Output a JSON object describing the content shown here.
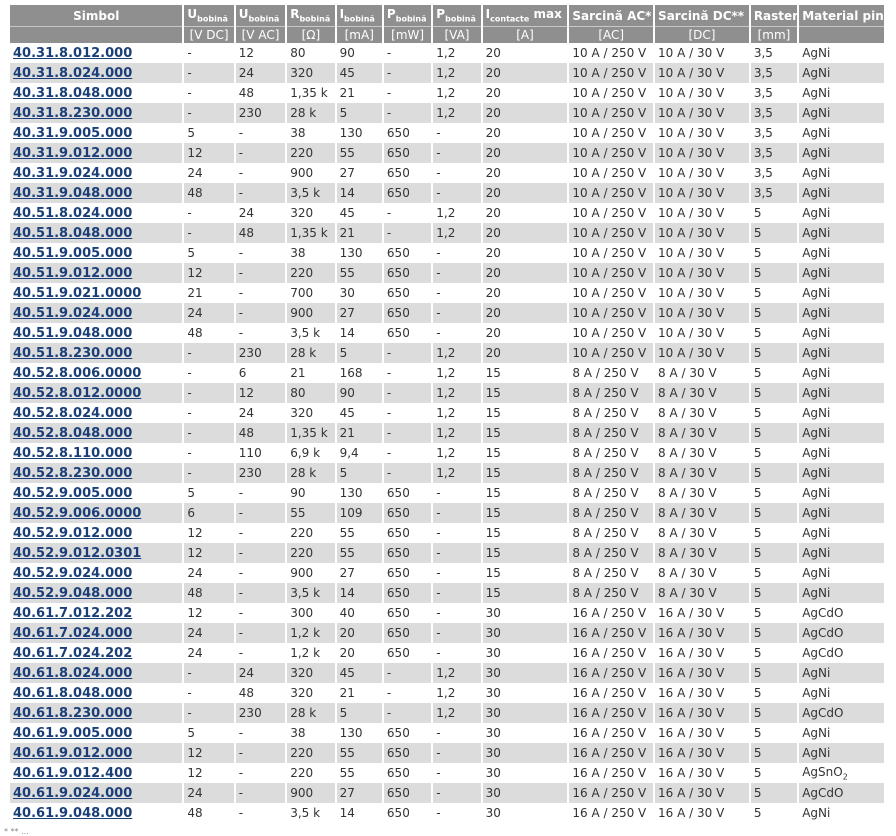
{
  "headers": {
    "symbol": "Simbol",
    "u_dc": {
      "base": "U",
      "sub": "bobină"
    },
    "u_ac": {
      "base": "U",
      "sub": "bobină"
    },
    "r": {
      "base": "R",
      "sub": "bobină"
    },
    "i": {
      "base": "I",
      "sub": "bobină"
    },
    "p_mw": {
      "base": "P",
      "sub": "bobină"
    },
    "p_va": {
      "base": "P",
      "sub": "bobină"
    },
    "i_contact": {
      "base": "I",
      "sub": "contacte",
      "suffix": " max"
    },
    "load_ac": "Sarcină AC*",
    "load_dc": "Sarcină DC**",
    "raster": "Raster",
    "material": "Material pin"
  },
  "units": [
    "",
    "[V DC]",
    "[V AC]",
    "[Ω]",
    "[mA]",
    "[mW]",
    "[VA]",
    "[A]",
    "[AC]",
    "[DC]",
    "[mm]",
    ""
  ],
  "rows": [
    [
      "40.31.8.012.000",
      "-",
      "12",
      "80",
      "90",
      "-",
      "1,2",
      "20",
      "10 A / 250 V",
      "10 A / 30 V",
      "3,5",
      "AgNi"
    ],
    [
      "40.31.8.024.000",
      "-",
      "24",
      "320",
      "45",
      "-",
      "1,2",
      "20",
      "10 A / 250 V",
      "10 A / 30 V",
      "3,5",
      "AgNi"
    ],
    [
      "40.31.8.048.000",
      "-",
      "48",
      "1,35 k",
      "21",
      "-",
      "1,2",
      "20",
      "10 A / 250 V",
      "10 A / 30 V",
      "3,5",
      "AgNi"
    ],
    [
      "40.31.8.230.000",
      "-",
      "230",
      "28 k",
      "5",
      "-",
      "1,2",
      "20",
      "10 A / 250 V",
      "10 A / 30 V",
      "3,5",
      "AgNi"
    ],
    [
      "40.31.9.005.000",
      "5",
      "-",
      "38",
      "130",
      "650",
      "-",
      "20",
      "10 A / 250 V",
      "10 A / 30 V",
      "3,5",
      "AgNi"
    ],
    [
      "40.31.9.012.000",
      "12",
      "-",
      "220",
      "55",
      "650",
      "-",
      "20",
      "10 A / 250 V",
      "10 A / 30 V",
      "3,5",
      "AgNi"
    ],
    [
      "40.31.9.024.000",
      "24",
      "-",
      "900",
      "27",
      "650",
      "-",
      "20",
      "10 A / 250 V",
      "10 A / 30 V",
      "3,5",
      "AgNi"
    ],
    [
      "40.31.9.048.000",
      "48",
      "-",
      "3,5 k",
      "14",
      "650",
      "-",
      "20",
      "10 A / 250 V",
      "10 A / 30 V",
      "3,5",
      "AgNi"
    ],
    [
      "40.51.8.024.000",
      "-",
      "24",
      "320",
      "45",
      "-",
      "1,2",
      "20",
      "10 A / 250 V",
      "10 A / 30 V",
      "5",
      "AgNi"
    ],
    [
      "40.51.8.048.000",
      "-",
      "48",
      "1,35 k",
      "21",
      "-",
      "1,2",
      "20",
      "10 A / 250 V",
      "10 A / 30 V",
      "5",
      "AgNi"
    ],
    [
      "40.51.9.005.000",
      "5",
      "-",
      "38",
      "130",
      "650",
      "-",
      "20",
      "10 A / 250 V",
      "10 A / 30 V",
      "5",
      "AgNi"
    ],
    [
      "40.51.9.012.000",
      "12",
      "-",
      "220",
      "55",
      "650",
      "-",
      "20",
      "10 A / 250 V",
      "10 A / 30 V",
      "5",
      "AgNi"
    ],
    [
      "40.51.9.021.0000",
      "21",
      "-",
      "700",
      "30",
      "650",
      "-",
      "20",
      "10 A / 250 V",
      "10 A / 30 V",
      "5",
      "AgNi"
    ],
    [
      "40.51.9.024.000",
      "24",
      "-",
      "900",
      "27",
      "650",
      "-",
      "20",
      "10 A / 250 V",
      "10 A / 30 V",
      "5",
      "AgNi"
    ],
    [
      "40.51.9.048.000",
      "48",
      "-",
      "3,5 k",
      "14",
      "650",
      "-",
      "20",
      "10 A / 250 V",
      "10 A / 30 V",
      "5",
      "AgNi"
    ],
    [
      "40.51.8.230.000",
      "-",
      "230",
      "28 k",
      "5",
      "-",
      "1,2",
      "20",
      "10 A / 250 V",
      "10 A / 30 V",
      "5",
      "AgNi"
    ],
    [
      "40.52.8.006.0000",
      "-",
      "6",
      "21",
      "168",
      "-",
      "1,2",
      "15",
      "8 A / 250 V",
      "8 A / 30 V",
      "5",
      "AgNi"
    ],
    [
      "40.52.8.012.0000",
      "-",
      "12",
      "80",
      "90",
      "-",
      "1,2",
      "15",
      "8 A / 250 V",
      "8 A / 30 V",
      "5",
      "AgNi"
    ],
    [
      "40.52.8.024.000",
      "-",
      "24",
      "320",
      "45",
      "-",
      "1,2",
      "15",
      "8 A / 250 V",
      "8 A / 30 V",
      "5",
      "AgNi"
    ],
    [
      "40.52.8.048.000",
      "-",
      "48",
      "1,35 k",
      "21",
      "-",
      "1,2",
      "15",
      "8 A / 250 V",
      "8 A / 30 V",
      "5",
      "AgNi"
    ],
    [
      "40.52.8.110.000",
      "-",
      "110",
      "6,9 k",
      "9,4",
      "-",
      "1,2",
      "15",
      "8 A / 250 V",
      "8 A / 30 V",
      "5",
      "AgNi"
    ],
    [
      "40.52.8.230.000",
      "-",
      "230",
      "28 k",
      "5",
      "-",
      "1,2",
      "15",
      "8 A / 250 V",
      "8 A / 30 V",
      "5",
      "AgNi"
    ],
    [
      "40.52.9.005.000",
      "5",
      "-",
      "90",
      "130",
      "650",
      "-",
      "15",
      "8 A / 250 V",
      "8 A / 30 V",
      "5",
      "AgNi"
    ],
    [
      "40.52.9.006.0000",
      "6",
      "-",
      "55",
      "109",
      "650",
      "-",
      "15",
      "8 A / 250 V",
      "8 A / 30 V",
      "5",
      "AgNi"
    ],
    [
      "40.52.9.012.000",
      "12",
      "-",
      "220",
      "55",
      "650",
      "-",
      "15",
      "8 A / 250 V",
      "8 A / 30 V",
      "5",
      "AgNi"
    ],
    [
      "40.52.9.012.0301",
      "12",
      "-",
      "220",
      "55",
      "650",
      "-",
      "15",
      "8 A / 250 V",
      "8 A / 30 V",
      "5",
      "AgNi"
    ],
    [
      "40.52.9.024.000",
      "24",
      "-",
      "900",
      "27",
      "650",
      "-",
      "15",
      "8 A / 250 V",
      "8 A / 30 V",
      "5",
      "AgNi"
    ],
    [
      "40.52.9.048.000",
      "48",
      "-",
      "3,5 k",
      "14",
      "650",
      "-",
      "15",
      "8 A / 250 V",
      "8 A / 30 V",
      "5",
      "AgNi"
    ],
    [
      "40.61.7.012.202",
      "12",
      "-",
      "300",
      "40",
      "650",
      "-",
      "30",
      "16 A / 250 V",
      "16 A / 30 V",
      "5",
      "AgCdO"
    ],
    [
      "40.61.7.024.000",
      "24",
      "-",
      "1,2 k",
      "20",
      "650",
      "-",
      "30",
      "16 A / 250 V",
      "16 A / 30 V",
      "5",
      "AgCdO"
    ],
    [
      "40.61.7.024.202",
      "24",
      "-",
      "1,2 k",
      "20",
      "650",
      "-",
      "30",
      "16 A / 250 V",
      "16 A / 30 V",
      "5",
      "AgCdO"
    ],
    [
      "40.61.8.024.000",
      "-",
      "24",
      "320",
      "45",
      "-",
      "1,2",
      "30",
      "16 A / 250 V",
      "16 A / 30 V",
      "5",
      "AgNi"
    ],
    [
      "40.61.8.048.000",
      "-",
      "48",
      "320",
      "21",
      "-",
      "1,2",
      "30",
      "16 A / 250 V",
      "16 A / 30 V",
      "5",
      "AgNi"
    ],
    [
      "40.61.8.230.000",
      "-",
      "230",
      "28 k",
      "5",
      "-",
      "1,2",
      "30",
      "16 A / 250 V",
      "16 A / 30 V",
      "5",
      "AgCdO"
    ],
    [
      "40.61.9.005.000",
      "5",
      "-",
      "38",
      "130",
      "650",
      "-",
      "30",
      "16 A / 250 V",
      "16 A / 30 V",
      "5",
      "AgNi"
    ],
    [
      "40.61.9.012.000",
      "12",
      "-",
      "220",
      "55",
      "650",
      "-",
      "30",
      "16 A / 250 V",
      "16 A / 30 V",
      "5",
      "AgNi"
    ],
    [
      "40.61.9.012.400",
      "12",
      "-",
      "220",
      "55",
      "650",
      "-",
      "30",
      "16 A / 250 V",
      "16 A / 30 V",
      "5",
      "AgSnO|2"
    ],
    [
      "40.61.9.024.000",
      "24",
      "-",
      "900",
      "27",
      "650",
      "-",
      "30",
      "16 A / 250 V",
      "16 A / 30 V",
      "5",
      "AgCdO"
    ],
    [
      "40.61.9.048.000",
      "48",
      "-",
      "3,5 k",
      "14",
      "650",
      "-",
      "30",
      "16 A / 250 V",
      "16 A / 30 V",
      "5",
      "AgNi"
    ]
  ],
  "footnote": "* ** ...",
  "colors": {
    "header_bg": "#8f8f8f",
    "alt_row_bg": "#dcdcdc",
    "link": "#1a3f78",
    "text": "#333333"
  }
}
